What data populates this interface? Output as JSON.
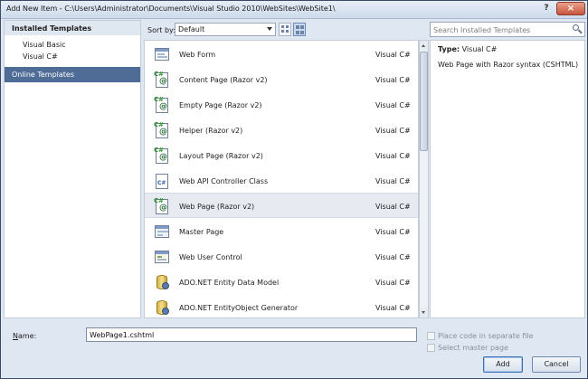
{
  "window": {
    "title": "Add New Item - C:\\Users\\Administrator\\Documents\\Visual Studio 2010\\WebSites\\WebSite1\\",
    "help_label": "?",
    "close_label": "×"
  },
  "sidebar": {
    "installed_label": "Installed Templates",
    "items": [
      {
        "label": "Visual Basic"
      },
      {
        "label": "Visual C#"
      }
    ],
    "online_label": "Online Templates"
  },
  "toolbar": {
    "sort_label": "Sort by:",
    "sort_value": "Default",
    "views": [
      "small-icons",
      "medium-icons"
    ]
  },
  "search": {
    "placeholder": "Search Installed Templates"
  },
  "templates": [
    {
      "name": "Web Form",
      "lang": "Visual C#",
      "icon": "web-form-icon"
    },
    {
      "name": "Content Page (Razor v2)",
      "lang": "Visual C#",
      "icon": "razor-page-icon"
    },
    {
      "name": "Empty Page (Razor v2)",
      "lang": "Visual C#",
      "icon": "razor-page-icon"
    },
    {
      "name": "Helper (Razor v2)",
      "lang": "Visual C#",
      "icon": "razor-page-icon"
    },
    {
      "name": "Layout Page (Razor v2)",
      "lang": "Visual C#",
      "icon": "razor-page-icon"
    },
    {
      "name": "Web API Controller Class",
      "lang": "Visual C#",
      "icon": "csharp-class-icon"
    },
    {
      "name": "Web Page (Razor v2)",
      "lang": "Visual C#",
      "icon": "razor-page-icon",
      "selected": true
    },
    {
      "name": "Master Page",
      "lang": "Visual C#",
      "icon": "master-page-icon"
    },
    {
      "name": "Web User Control",
      "lang": "Visual C#",
      "icon": "user-control-icon"
    },
    {
      "name": "ADO.NET Entity Data Model",
      "lang": "Visual C#",
      "icon": "entity-model-icon"
    },
    {
      "name": "ADO.NET EntityObject Generator",
      "lang": "Visual C#",
      "icon": "entity-generator-icon"
    }
  ],
  "info": {
    "type_label": "Type:",
    "type_value": "Visual C#",
    "description": "Web Page with Razor syntax (CSHTML)"
  },
  "bottom": {
    "name_label_prefix": "N",
    "name_label_rest": "ame:",
    "name_value": "WebPage1.cshtml",
    "place_code_label": "Place code in separate file",
    "master_page_label": "Select master page",
    "add_label": "Add",
    "cancel_label": "Cancel"
  }
}
